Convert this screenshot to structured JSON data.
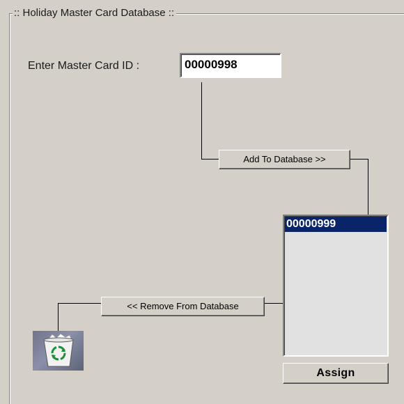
{
  "group": {
    "title": ":: Holiday Master Card Database ::"
  },
  "form": {
    "id_label": "Enter Master Card ID :",
    "id_value": "00000998"
  },
  "buttons": {
    "add_label": "Add To Database >>",
    "remove_label": "<< Remove From Database",
    "assign_label": "Assign"
  },
  "database_list": {
    "items": [
      "00000999"
    ],
    "selected_index": 0
  },
  "icons": {
    "trash": "recycle-bin-icon"
  },
  "colors": {
    "background": "#d4d0c8",
    "selection": "#0a246a",
    "list_background": "#e1e1e1"
  }
}
